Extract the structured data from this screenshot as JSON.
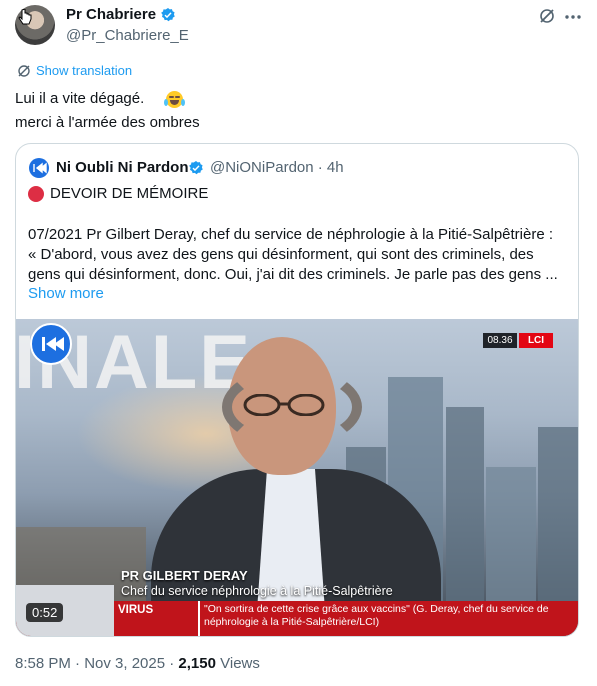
{
  "author": {
    "display_name": "Pr Chabriere",
    "handle": "@Pr_Chabriere_E",
    "verified": true
  },
  "header_icons": [
    "grok-icon",
    "more-icon"
  ],
  "translation": {
    "label": "Show translation"
  },
  "tweet": {
    "text": "Lui il a vite dégagé. \nmerci à l'armée des ombres",
    "emoji": "face-with-tears-of-joy"
  },
  "quote": {
    "display_name": "Ni Oubli Ni Pardon",
    "handle": "@NiONiPardon · 4h",
    "verified": true,
    "title": "DEVOIR DE MÉMOIRE",
    "body": "07/2021 Pr Gilbert Deray, chef du service de néphrologie à la Pitié-Salpêtrière :\n« D'abord, vous avez des gens qui désinforment, qui sont des criminels, des gens qui désinforment, donc. Oui, j'ai dit des criminels. Je parle pas des gens ...",
    "show_more": "Show more"
  },
  "video": {
    "overlay_word": "INALE",
    "clock": "08.36",
    "channel": "LCI",
    "lower_third_name": "PR GILBERT DERAY",
    "lower_third_role": "Chef du service néphrologie à la Pitié-Salpêtrière",
    "ticker_label": "VIRUS",
    "ticker_text": "\"On sortira de cette crise grâce aux vaccins\" (G. Deray, chef du service de néphrologie à la Pitié-Salpêtrière/LCI)",
    "duration": "0:52"
  },
  "footer": {
    "timestamp": "8:58 PM · Nov 3, 2025 · ",
    "views_count": "2,150",
    "views_label": " Views"
  },
  "colors": {
    "link": "#1d9bf0",
    "muted": "#536471",
    "verified": "#1d9bf0",
    "lci_red": "#e30613"
  }
}
